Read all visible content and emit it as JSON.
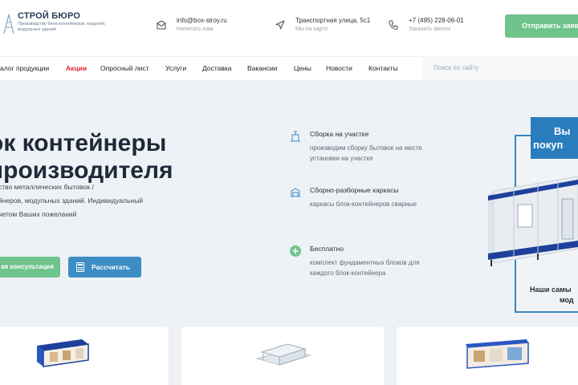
{
  "header": {
    "logo_title": "СТРОЙ БЮРО",
    "logo_subtitle": "Производство блок-контейнеров, модулей, модульных зданий",
    "email": {
      "main": "info@box-stroy.ru",
      "sub": "Написать нам",
      "icon": "envelope-icon"
    },
    "address": {
      "main": "Транспортная улица, 5с1",
      "sub": "Мы на карте",
      "icon": "location-arrow-icon"
    },
    "phone": {
      "main": "+7 (495) 228-06-01",
      "sub": "Заказать звонок",
      "icon": "phone-icon"
    },
    "order_button": "Отправить заявку"
  },
  "nav": {
    "items": [
      "алог продукции",
      "Акции",
      "Опросный лист",
      "Услуги",
      "Доставка",
      "Вакансии",
      "Цены",
      "Новости",
      "Контакты"
    ],
    "active_index": 1,
    "search_placeholder": "Поиск по сайту"
  },
  "hero": {
    "title_line1": "ок контейнеры",
    "title_line2": "производителя",
    "desc_line1": "ство металлических бытовок /",
    "desc_line2": "йнеров, модульных зданий. Индивидуальный",
    "desc_line3": "четом Ваших пожеланий",
    "consult_button": "ая консультация",
    "calc_button": "Рассчитать",
    "features": [
      {
        "title": "Сборка на участке",
        "desc": "производим сборку бытовок на месте установки на участке",
        "icon": "crane-icon"
      },
      {
        "title": "Сборно-разборные каркасы",
        "desc": "каркасы блок-контейнеров сварные",
        "icon": "frame-icon"
      },
      {
        "title": "Бесплатно",
        "desc": "комплект фундаментных блоков для каждого блок-контейнера",
        "icon": "plus-circle-icon"
      }
    ],
    "promo": {
      "head_line1": "Вы",
      "head_line2": "покуп",
      "caption_line1": "Наши самы",
      "caption_line2": "мод"
    }
  },
  "colors": {
    "accent_green": "#6fc48b",
    "accent_blue": "#3d8cc4",
    "active_red": "#e0242b",
    "hero_bg": "#eef2f6"
  }
}
